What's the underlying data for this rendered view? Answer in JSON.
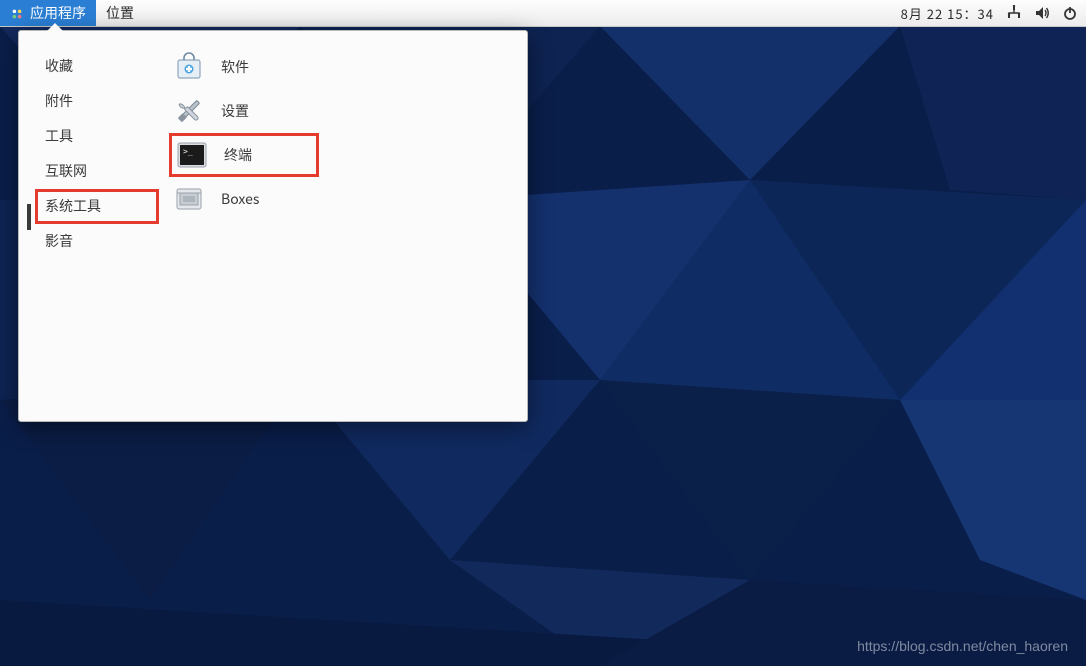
{
  "panel": {
    "applications_label": "应用程序",
    "places_label": "位置",
    "clock": "8月 22  15：34"
  },
  "tray": {
    "network_icon": "network-icon",
    "volume_icon": "volume-icon",
    "power_icon": "power-icon"
  },
  "menu": {
    "categories": {
      "favorites": "收藏",
      "accessories": "附件",
      "tools": "工具",
      "internet": "互联网",
      "system_tools": "系统工具",
      "multimedia": "影音"
    },
    "apps": {
      "software": "软件",
      "settings": "设置",
      "terminal": "终端",
      "boxes": "Boxes"
    }
  },
  "watermark": "https://blog.csdn.net/chen_haoren",
  "colors": {
    "panel_active": "#2a7fd5",
    "highlight_box": "#e33b2e",
    "wallpaper_base": "#0a1e4a"
  }
}
